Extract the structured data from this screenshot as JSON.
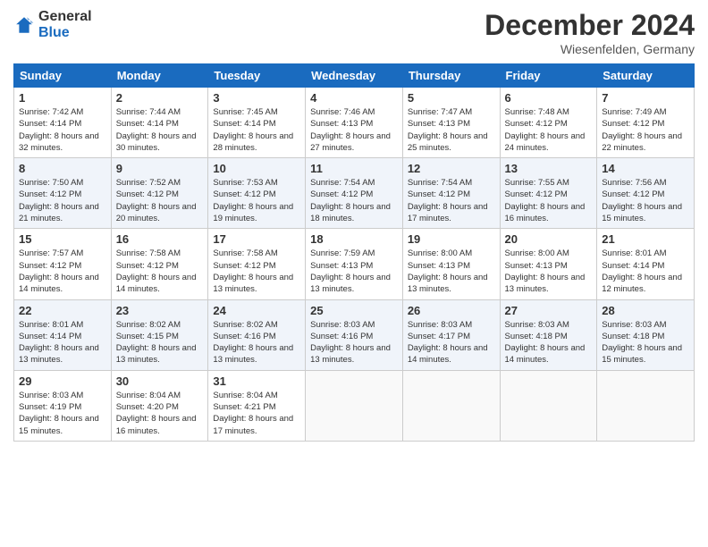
{
  "header": {
    "logo_general": "General",
    "logo_blue": "Blue",
    "month_title": "December 2024",
    "location": "Wiesenfelden, Germany"
  },
  "days_of_week": [
    "Sunday",
    "Monday",
    "Tuesday",
    "Wednesday",
    "Thursday",
    "Friday",
    "Saturday"
  ],
  "weeks": [
    [
      {
        "day": "1",
        "sunrise": "7:42 AM",
        "sunset": "4:14 PM",
        "daylight": "8 hours and 32 minutes."
      },
      {
        "day": "2",
        "sunrise": "7:44 AM",
        "sunset": "4:14 PM",
        "daylight": "8 hours and 30 minutes."
      },
      {
        "day": "3",
        "sunrise": "7:45 AM",
        "sunset": "4:14 PM",
        "daylight": "8 hours and 28 minutes."
      },
      {
        "day": "4",
        "sunrise": "7:46 AM",
        "sunset": "4:13 PM",
        "daylight": "8 hours and 27 minutes."
      },
      {
        "day": "5",
        "sunrise": "7:47 AM",
        "sunset": "4:13 PM",
        "daylight": "8 hours and 25 minutes."
      },
      {
        "day": "6",
        "sunrise": "7:48 AM",
        "sunset": "4:12 PM",
        "daylight": "8 hours and 24 minutes."
      },
      {
        "day": "7",
        "sunrise": "7:49 AM",
        "sunset": "4:12 PM",
        "daylight": "8 hours and 22 minutes."
      }
    ],
    [
      {
        "day": "8",
        "sunrise": "7:50 AM",
        "sunset": "4:12 PM",
        "daylight": "8 hours and 21 minutes."
      },
      {
        "day": "9",
        "sunrise": "7:52 AM",
        "sunset": "4:12 PM",
        "daylight": "8 hours and 20 minutes."
      },
      {
        "day": "10",
        "sunrise": "7:53 AM",
        "sunset": "4:12 PM",
        "daylight": "8 hours and 19 minutes."
      },
      {
        "day": "11",
        "sunrise": "7:54 AM",
        "sunset": "4:12 PM",
        "daylight": "8 hours and 18 minutes."
      },
      {
        "day": "12",
        "sunrise": "7:54 AM",
        "sunset": "4:12 PM",
        "daylight": "8 hours and 17 minutes."
      },
      {
        "day": "13",
        "sunrise": "7:55 AM",
        "sunset": "4:12 PM",
        "daylight": "8 hours and 16 minutes."
      },
      {
        "day": "14",
        "sunrise": "7:56 AM",
        "sunset": "4:12 PM",
        "daylight": "8 hours and 15 minutes."
      }
    ],
    [
      {
        "day": "15",
        "sunrise": "7:57 AM",
        "sunset": "4:12 PM",
        "daylight": "8 hours and 14 minutes."
      },
      {
        "day": "16",
        "sunrise": "7:58 AM",
        "sunset": "4:12 PM",
        "daylight": "8 hours and 14 minutes."
      },
      {
        "day": "17",
        "sunrise": "7:58 AM",
        "sunset": "4:12 PM",
        "daylight": "8 hours and 13 minutes."
      },
      {
        "day": "18",
        "sunrise": "7:59 AM",
        "sunset": "4:13 PM",
        "daylight": "8 hours and 13 minutes."
      },
      {
        "day": "19",
        "sunrise": "8:00 AM",
        "sunset": "4:13 PM",
        "daylight": "8 hours and 13 minutes."
      },
      {
        "day": "20",
        "sunrise": "8:00 AM",
        "sunset": "4:13 PM",
        "daylight": "8 hours and 13 minutes."
      },
      {
        "day": "21",
        "sunrise": "8:01 AM",
        "sunset": "4:14 PM",
        "daylight": "8 hours and 12 minutes."
      }
    ],
    [
      {
        "day": "22",
        "sunrise": "8:01 AM",
        "sunset": "4:14 PM",
        "daylight": "8 hours and 13 minutes."
      },
      {
        "day": "23",
        "sunrise": "8:02 AM",
        "sunset": "4:15 PM",
        "daylight": "8 hours and 13 minutes."
      },
      {
        "day": "24",
        "sunrise": "8:02 AM",
        "sunset": "4:16 PM",
        "daylight": "8 hours and 13 minutes."
      },
      {
        "day": "25",
        "sunrise": "8:03 AM",
        "sunset": "4:16 PM",
        "daylight": "8 hours and 13 minutes."
      },
      {
        "day": "26",
        "sunrise": "8:03 AM",
        "sunset": "4:17 PM",
        "daylight": "8 hours and 14 minutes."
      },
      {
        "day": "27",
        "sunrise": "8:03 AM",
        "sunset": "4:18 PM",
        "daylight": "8 hours and 14 minutes."
      },
      {
        "day": "28",
        "sunrise": "8:03 AM",
        "sunset": "4:18 PM",
        "daylight": "8 hours and 15 minutes."
      }
    ],
    [
      {
        "day": "29",
        "sunrise": "8:03 AM",
        "sunset": "4:19 PM",
        "daylight": "8 hours and 15 minutes."
      },
      {
        "day": "30",
        "sunrise": "8:04 AM",
        "sunset": "4:20 PM",
        "daylight": "8 hours and 16 minutes."
      },
      {
        "day": "31",
        "sunrise": "8:04 AM",
        "sunset": "4:21 PM",
        "daylight": "8 hours and 17 minutes."
      },
      null,
      null,
      null,
      null
    ]
  ]
}
